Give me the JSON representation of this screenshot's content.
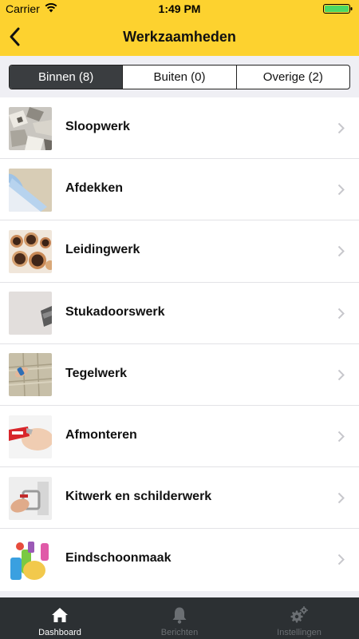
{
  "status_bar": {
    "carrier": "Carrier",
    "time": "1:49 PM"
  },
  "nav": {
    "title": "Werkzaamheden",
    "back_icon": "chevron-left-icon"
  },
  "segments": [
    {
      "label": "Binnen (8)",
      "selected": true
    },
    {
      "label": "Buiten (0)",
      "selected": false
    },
    {
      "label": "Overige (2)",
      "selected": false
    }
  ],
  "items": [
    {
      "label": "Sloopwerk"
    },
    {
      "label": "Afdekken"
    },
    {
      "label": "Leidingwerk"
    },
    {
      "label": "Stukadoorswerk"
    },
    {
      "label": "Tegelwerk"
    },
    {
      "label": "Afmonteren"
    },
    {
      "label": "Kitwerk en schilderwerk"
    },
    {
      "label": "Eindschoonmaak"
    }
  ],
  "tabbar": {
    "items": [
      {
        "label": "Dashboard",
        "icon": "home-icon",
        "active": true
      },
      {
        "label": "Berichten",
        "icon": "bell-icon",
        "active": false
      },
      {
        "label": "Instellingen",
        "icon": "gears-icon",
        "active": false
      }
    ]
  },
  "colors": {
    "header": "#fdd22f",
    "tabbar": "#2c3033",
    "segment_active": "#3a3d40",
    "battery": "#4cd964"
  }
}
